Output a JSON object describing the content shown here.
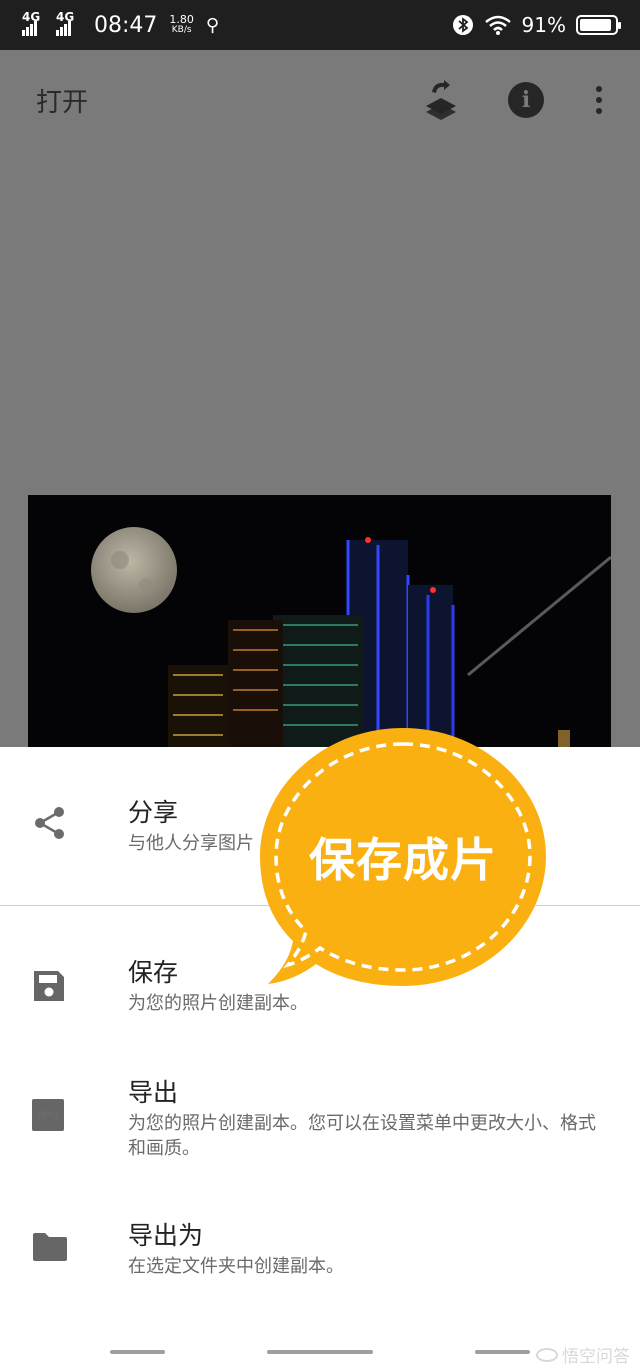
{
  "status_bar": {
    "network1": "4G",
    "network2": "4G",
    "time": "08:47",
    "speed_value": "1.80",
    "speed_unit": "KB/s",
    "battery_percent": "91%",
    "battery_level": 0.91
  },
  "toolbar": {
    "open_label": "打开",
    "icons": [
      "layers-rotate-icon",
      "info-icon",
      "more-vert-icon"
    ]
  },
  "sheet": {
    "items": [
      {
        "icon": "share-icon",
        "title": "分享",
        "desc": "与他人分享图片"
      },
      {
        "icon": "save-icon",
        "title": "保存",
        "desc": "为您的照片创建副本。"
      },
      {
        "icon": "jpg-icon",
        "icon_text": "JPG",
        "title": "导出",
        "desc": "为您的照片创建副本。您可以在设置菜单中更改大小、格式和画质。"
      },
      {
        "icon": "folder-icon",
        "title": "导出为",
        "desc": "在选定文件夹中创建副本。"
      }
    ]
  },
  "callout": {
    "text": "保存成片",
    "color": "#FBB012"
  },
  "watermark": {
    "text": "悟空问答"
  }
}
